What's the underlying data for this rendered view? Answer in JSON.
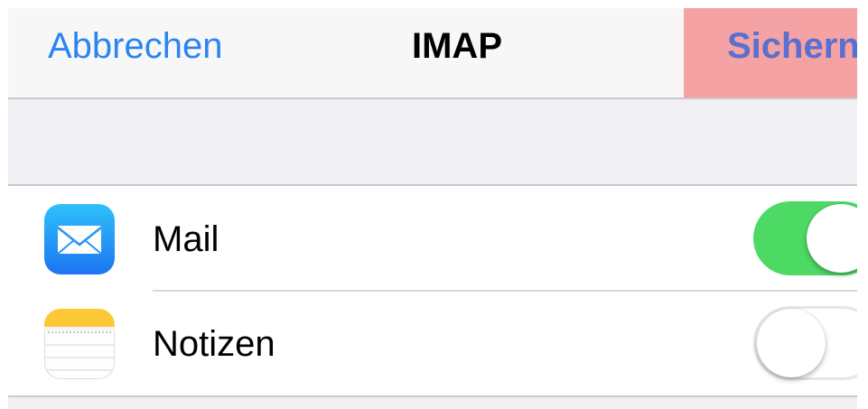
{
  "navbar": {
    "cancel_label": "Abbrechen",
    "title": "IMAP",
    "save_label": "Sichern"
  },
  "services": [
    {
      "label": "Mail",
      "icon": "mail-icon",
      "enabled": true
    },
    {
      "label": "Notizen",
      "icon": "notes-icon",
      "enabled": false
    }
  ],
  "colors": {
    "accent_blue": "#2c84f0",
    "toggle_on": "#4cd964",
    "save_highlight": "#f4a2a3",
    "save_text": "#5b6fcf"
  }
}
